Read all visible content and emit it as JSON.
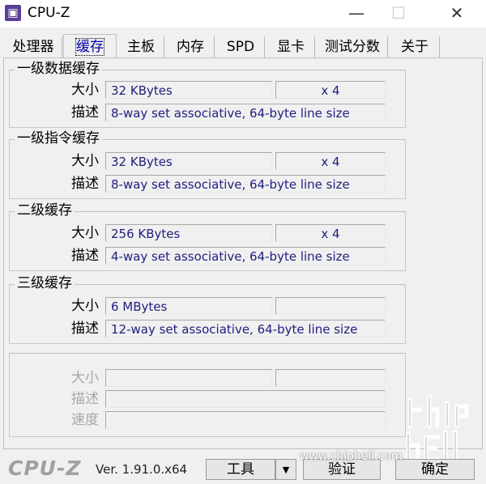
{
  "window": {
    "title": "CPU-Z",
    "icon_glyph": "▣",
    "minimize_glyph": "—",
    "maximize_glyph": "☐",
    "close_glyph": "✕"
  },
  "tabs": [
    {
      "label": "处理器",
      "active": false
    },
    {
      "label": "缓存",
      "active": true
    },
    {
      "label": "主板",
      "active": false
    },
    {
      "label": "内存",
      "active": false
    },
    {
      "label": "SPD",
      "active": false
    },
    {
      "label": "显卡",
      "active": false
    },
    {
      "label": "测试分数",
      "active": false
    },
    {
      "label": "关于",
      "active": false
    }
  ],
  "groups": [
    {
      "title": "一级数据缓存",
      "size_label": "大小",
      "size_value": "32 KBytes",
      "count": "x 4",
      "desc_label": "描述",
      "desc_value": "8-way set associative, 64-byte line size"
    },
    {
      "title": "一级指令缓存",
      "size_label": "大小",
      "size_value": "32 KBytes",
      "count": "x 4",
      "desc_label": "描述",
      "desc_value": "8-way set associative, 64-byte line size"
    },
    {
      "title": "二级缓存",
      "size_label": "大小",
      "size_value": "256 KBytes",
      "count": "x 4",
      "desc_label": "描述",
      "desc_value": "4-way set associative, 64-byte line size"
    },
    {
      "title": "三级缓存",
      "size_label": "大小",
      "size_value": "6 MBytes",
      "count": "",
      "desc_label": "描述",
      "desc_value": "12-way set associative, 64-byte line size"
    }
  ],
  "empty_group": {
    "size_label": "大小",
    "desc_label": "描述",
    "speed_label": "速度"
  },
  "bottom": {
    "brand": "CPU-Z",
    "version": "Ver. 1.91.0.x64",
    "tools_label": "工具",
    "dropdown_glyph": "▼",
    "validate_label": "验证",
    "ok_label": "确定"
  },
  "watermark": {
    "url": "www.chiphell.com"
  },
  "colors": {
    "value_text": "#202080",
    "active_tab": "#0000aa",
    "icon_bg": "#5b3f96"
  }
}
